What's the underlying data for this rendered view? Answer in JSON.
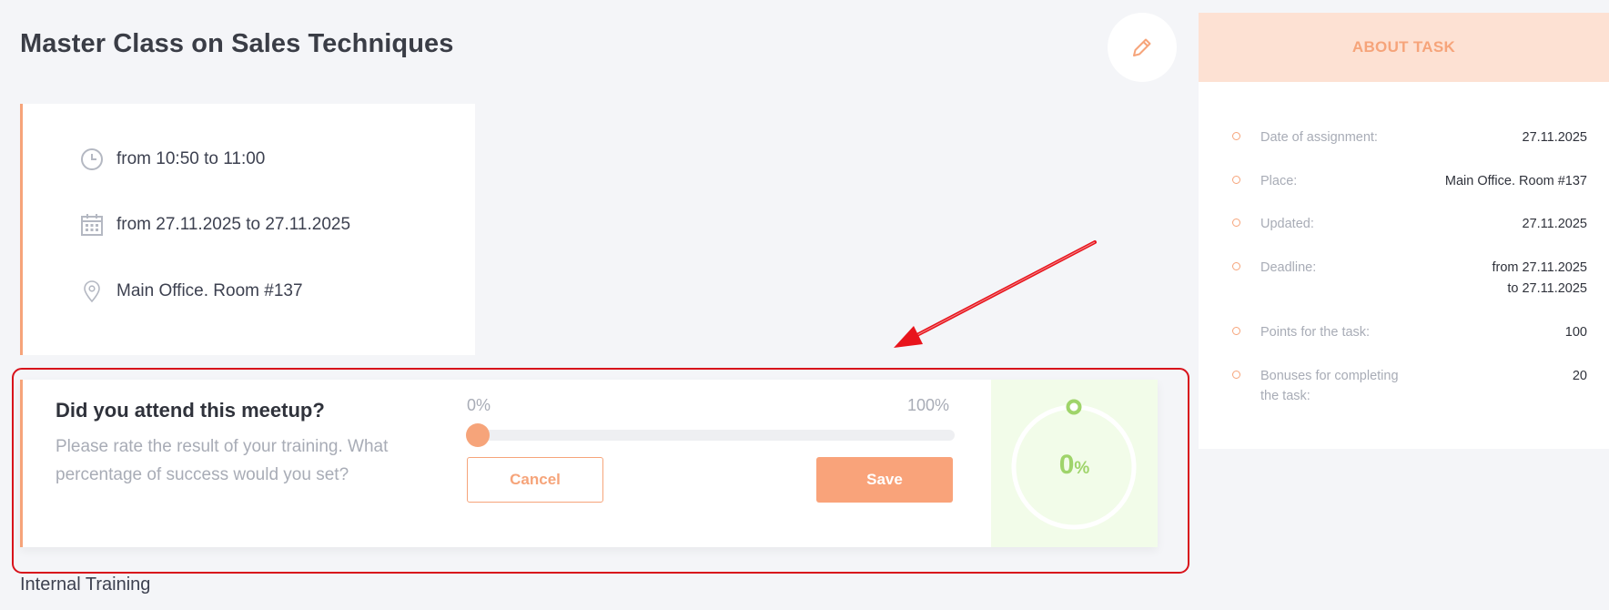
{
  "page": {
    "title": "Master Class on Sales Techniques"
  },
  "edit": {
    "icon": "pencil-icon"
  },
  "details": {
    "time": "from 10:50 to 11:00",
    "dates": "from 27.11.2025 to 27.11.2025",
    "place": "Main Office. Room #137"
  },
  "rating": {
    "question": "Did you attend this meetup?",
    "description": "Please rate the result of your training. What percentage of success would you set?",
    "min_label": "0%",
    "max_label": "100%",
    "value_percent": 0,
    "cancel_label": "Cancel",
    "save_label": "Save",
    "progress_number": "0",
    "progress_suffix": "%"
  },
  "category": "Internal Training",
  "about": {
    "header": "ABOUT TASK",
    "rows": [
      {
        "label": "Date of assignment:",
        "value": "27.11.2025"
      },
      {
        "label": "Place:",
        "value": "Main Office. Room #137"
      },
      {
        "label": "Updated:",
        "value": "27.11.2025"
      },
      {
        "label": "Deadline:",
        "value_line1": "from 27.11.2025",
        "value_line2": "to 27.11.2025"
      },
      {
        "label": "Points for the task:",
        "value": "100"
      },
      {
        "label_line1": "Bonuses for completing",
        "label_line2": "the task:",
        "value": "20"
      }
    ]
  },
  "colors": {
    "accent": "#f6a47a",
    "progress_green": "#9fd46a",
    "annotation_red": "#d8121b"
  }
}
